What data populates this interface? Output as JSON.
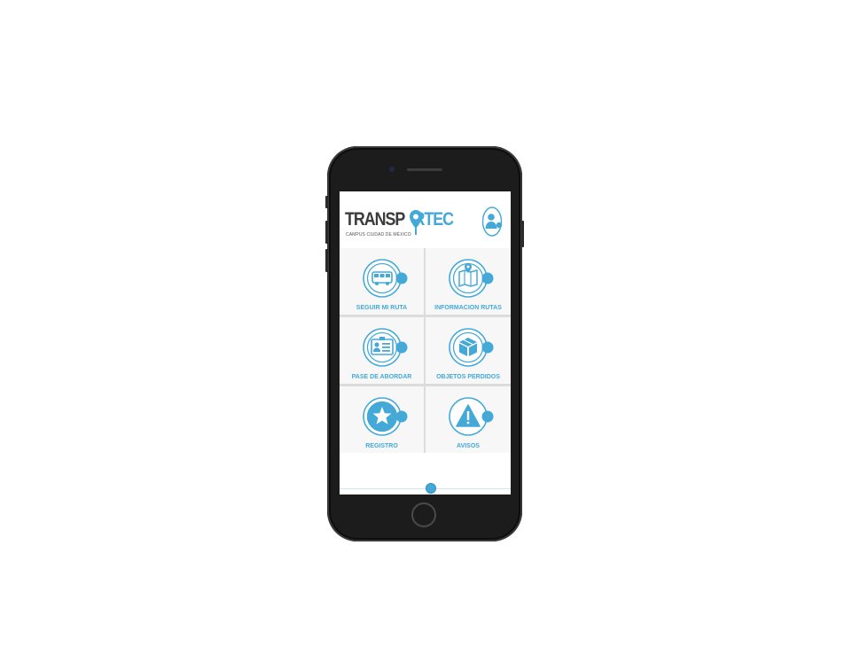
{
  "app": {
    "brand_part1": "TRANSP",
    "brand_part2": "RTEC",
    "brand_subtitle": "CAMPUS CIUDAD DE MÉXICO",
    "accent_color": "#45a9d8",
    "dark_color": "#3b3b3b"
  },
  "header": {
    "user_icon": "user-profile-icon"
  },
  "menu": [
    {
      "label": "SEGUIR MI RUTA",
      "icon": "bus-icon"
    },
    {
      "label": "INFORMACION RUTAS",
      "icon": "map-pin-icon"
    },
    {
      "label": "PASE DE ABORDAR",
      "icon": "id-card-icon"
    },
    {
      "label": "OBJETOS PERDIDOS",
      "icon": "box-icon"
    },
    {
      "label": "REGISTRO",
      "icon": "star-icon"
    },
    {
      "label": "AVISOS",
      "icon": "warning-icon"
    }
  ]
}
